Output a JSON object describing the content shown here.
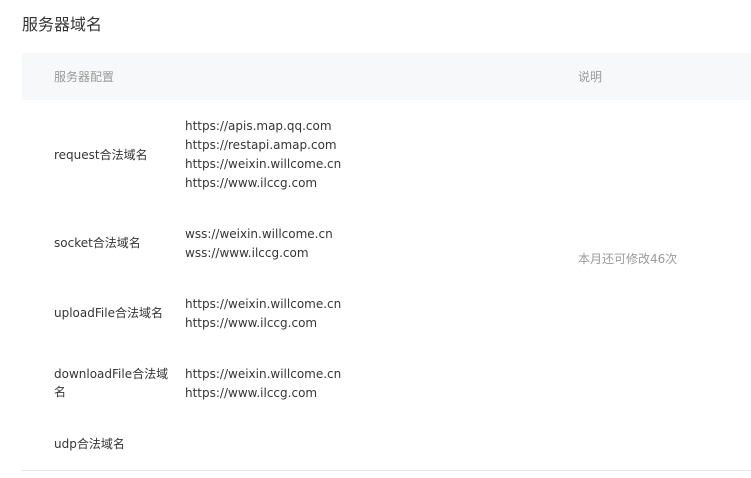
{
  "section": {
    "title": "服务器域名"
  },
  "table": {
    "headers": {
      "config": "服务器配置",
      "description": "说明"
    },
    "rows": [
      {
        "label": "request合法域名",
        "domains": [
          "https://apis.map.qq.com",
          "https://restapi.amap.com",
          "https://weixin.willcome.cn",
          "https://www.ilccg.com"
        ]
      },
      {
        "label": "socket合法域名",
        "domains": [
          "wss://weixin.willcome.cn",
          "wss://www.ilccg.com"
        ]
      },
      {
        "label": "uploadFile合法域名",
        "domains": [
          "https://weixin.willcome.cn",
          "https://www.ilccg.com"
        ]
      },
      {
        "label": "downloadFile合法域名",
        "domains": [
          "https://weixin.willcome.cn",
          "https://www.ilccg.com"
        ]
      },
      {
        "label": "udp合法域名",
        "domains": []
      }
    ],
    "description_text": "本月还可修改46次"
  }
}
